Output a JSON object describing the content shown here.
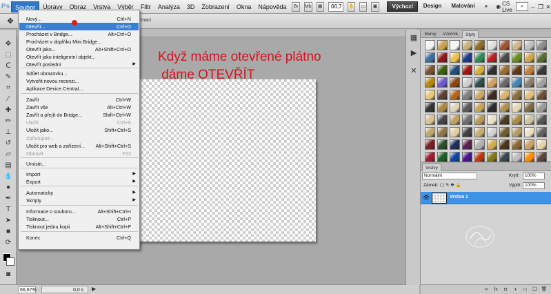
{
  "app": {
    "logo": "Ps"
  },
  "menubar": {
    "items": [
      "Soubor",
      "Úpravy",
      "Obraz",
      "Vrstva",
      "Výběr",
      "Filtr",
      "Analýza",
      "3D",
      "Zobrazení",
      "Okna",
      "Nápověda"
    ],
    "icon_br": "Br",
    "icon_mb": "Mb",
    "zoom": "66,7",
    "workspaces": [
      "Výchozí",
      "Design",
      "Malování"
    ],
    "cslive": "CS Live"
  },
  "options_bar": {
    "visible_text": "rmaci"
  },
  "file_menu": {
    "items": [
      {
        "label": "Nový...",
        "shortcut": "Ctrl+N"
      },
      {
        "label": "Otevřít...",
        "shortcut": "Ctrl+O",
        "highlight": true
      },
      {
        "label": "Procházet v Bridge...",
        "shortcut": "Alt+Ctrl+O"
      },
      {
        "label": "Procházet v doplňku Mini Bridge..."
      },
      {
        "label": "Otevřít jako...",
        "shortcut": "Alt+Shift+Ctrl+O"
      },
      {
        "label": "Otevřít jako inteligentní objekt..."
      },
      {
        "label": "Otevřít poslední",
        "submenu": true
      },
      {
        "label": "Sdílet obrazovku..."
      },
      {
        "label": "Vytvořit novou recenzi..."
      },
      {
        "label": "Aplikace Device Central..."
      },
      {
        "label": "Zavřít",
        "shortcut": "Ctrl+W"
      },
      {
        "label": "Zavřít vše",
        "shortcut": "Alt+Ctrl+W"
      },
      {
        "label": "Zavřít a přejít do Bridge...",
        "shortcut": "Shift+Ctrl+W"
      },
      {
        "label": "Uložit",
        "shortcut": "Ctrl+S",
        "disabled": true
      },
      {
        "label": "Uložit jako...",
        "shortcut": "Shift+Ctrl+S"
      },
      {
        "label": "Zpřístupnit...",
        "disabled": true
      },
      {
        "label": "Uložit pro web a zařízení...",
        "shortcut": "Alt+Shift+Ctrl+S"
      },
      {
        "label": "Obnovit",
        "shortcut": "F12",
        "disabled": true
      },
      {
        "label": "Umístit..."
      },
      {
        "label": "Import",
        "submenu": true
      },
      {
        "label": "Export",
        "submenu": true
      },
      {
        "label": "Automaticky",
        "submenu": true
      },
      {
        "label": "Skripty",
        "submenu": true
      },
      {
        "label": "Informace o souboru...",
        "shortcut": "Alt+Shift+Ctrl+I"
      },
      {
        "label": "Tisknout...",
        "shortcut": "Ctrl+P"
      },
      {
        "label": "Tisknout jednu kopii",
        "shortcut": "Alt+Shift+Ctrl+P"
      },
      {
        "label": "Konec",
        "shortcut": "Ctrl+Q"
      }
    ]
  },
  "annotation": {
    "line1": "Když máme otevřené plátno",
    "line2": " dáme OTEVŘÍT"
  },
  "statusbar": {
    "zoom": "66,67%",
    "doc": "0,0 s"
  },
  "styles_panel": {
    "tabs": [
      "Barvy",
      "Vzorník",
      "Styly"
    ],
    "swatch_colors": [
      "#f2f2f2",
      "#c8a24a",
      "#f5f5f5",
      "#c9b27a",
      "#8b6a2a",
      "#e0e0e0",
      "#a0522d",
      "#d2b48c",
      "#c0c0c0",
      "#8c8c8c",
      "#3c6e9e",
      "#8b1a1a",
      "#e8c04a",
      "#1e3a8a",
      "#2e8b57",
      "#b22222",
      "#4a4a4a",
      "#6b8e23",
      "#cfa74a",
      "#556b2f",
      "#7a5230",
      "#3a5f0b",
      "#1f4e79",
      "#a31515",
      "#d4af37",
      "#2f2f2f",
      "#9c6b30",
      "#5b3a1a",
      "#c08040",
      "#3a3a3a",
      "#b8860b",
      "#6a5acd",
      "#8b4513",
      "#cfcfcf",
      "#2f4f4f",
      "#d2a060",
      "#696969",
      "#4682b4",
      "#8b7d6b",
      "#a0a0a0",
      "#e6c87a",
      "#5c4033",
      "#b5651d",
      "#7f7f7f",
      "#c9a86a",
      "#3d2b1f",
      "#d9b36c",
      "#8a6d3b",
      "#e0c080",
      "#6f4e37",
      "#333333",
      "#aa8844",
      "#ddd3b8",
      "#5a5a5a",
      "#c4a35a",
      "#2b2b2b",
      "#b09050",
      "#e2d6b5",
      "#7d6a45",
      "#999999",
      "#d8c090",
      "#444444",
      "#c0a060",
      "#6e6e6e",
      "#b89a58",
      "#e8e0c8",
      "#4a3b22",
      "#a88a48",
      "#cfc4a4",
      "#555555",
      "#bfa76a",
      "#8c7446",
      "#e0cfa0",
      "#3f3f3f",
      "#c6ad72",
      "#d1d1d1",
      "#705a32",
      "#b39c6a",
      "#ebe2c6",
      "#616161",
      "#7a1f1f",
      "#2a4d2a",
      "#1f2f5a",
      "#5a1f4d",
      "#b0b0b0",
      "#d4aa50",
      "#4d3319",
      "#8c6633",
      "#c9a066",
      "#e6d2a8",
      "#9e1b32",
      "#1b5e20",
      "#0d47a1",
      "#4a148c",
      "#bf360c",
      "#827717",
      "#37474f",
      "#bdbdbd",
      "#ff8f00",
      "#5d4037"
    ]
  },
  "layers_panel": {
    "tab": "Vrstvy",
    "blend_mode": "Normální",
    "opacity_label": "Krytí:",
    "opacity_value": "100%",
    "lock_label": "Zámek:",
    "fill_label": "Výplň:",
    "fill_value": "100%",
    "layer_name": "Vrstva 1"
  }
}
